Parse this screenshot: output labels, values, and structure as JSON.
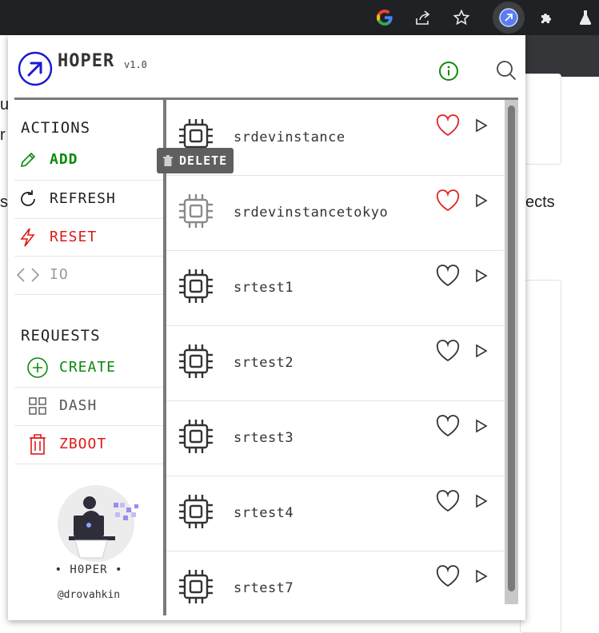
{
  "browser": {
    "toolbar_icons": [
      "google-icon",
      "share-icon",
      "star-icon",
      "hoper-extension-icon",
      "puzzle-extensions-icon",
      "lab-flask-icon"
    ]
  },
  "background_page": {
    "text_fragment_left_1": "u",
    "text_fragment_left_2": "r",
    "text_fragment_left_3": "s",
    "text_fragment_right": "ects"
  },
  "header": {
    "brand": "HOPER",
    "version": "v1.0",
    "info_icon": "info-icon",
    "search_icon": "search-icon"
  },
  "sidebar": {
    "actions_title": "ACTIONS",
    "actions": [
      {
        "label": "ADD",
        "icon": "pencil-icon",
        "color": "#0b8a0b"
      },
      {
        "label": "REFRESH",
        "icon": "refresh-icon",
        "color": "#222222"
      },
      {
        "label": "RESET",
        "icon": "lightning-icon",
        "color": "#e01818"
      },
      {
        "label": "IO",
        "icon": "code-brackets-icon",
        "color": "#9a9a9a"
      }
    ],
    "requests_title": "REQUESTS",
    "requests": [
      {
        "label": "CREATE",
        "icon": "plus-circle-icon",
        "color": "#0b8a0b"
      },
      {
        "label": "DASH",
        "icon": "grid-icon",
        "color": "#555555"
      },
      {
        "label": "ZBOOT",
        "icon": "trash-icon",
        "color": "#e01818"
      }
    ],
    "credit_name": "• H0PER •",
    "credit_handle": "@drovahkin"
  },
  "tooltip": {
    "label": "DELETE",
    "icon": "trash-icon"
  },
  "instances": [
    {
      "name": "srdevinstance",
      "favorite": true,
      "dimmed": false
    },
    {
      "name": "srdevinstancetokyo",
      "favorite": true,
      "dimmed": true
    },
    {
      "name": "srtest1",
      "favorite": false,
      "dimmed": false
    },
    {
      "name": "srtest2",
      "favorite": false,
      "dimmed": false
    },
    {
      "name": "srtest3",
      "favorite": false,
      "dimmed": false
    },
    {
      "name": "srtest4",
      "favorite": false,
      "dimmed": false
    },
    {
      "name": "srtest7",
      "favorite": false,
      "dimmed": false
    }
  ],
  "colors": {
    "accent_blue": "#1a1ad6",
    "favorite_red": "#e02424",
    "green": "#0b8a0b",
    "red": "#e01818"
  }
}
